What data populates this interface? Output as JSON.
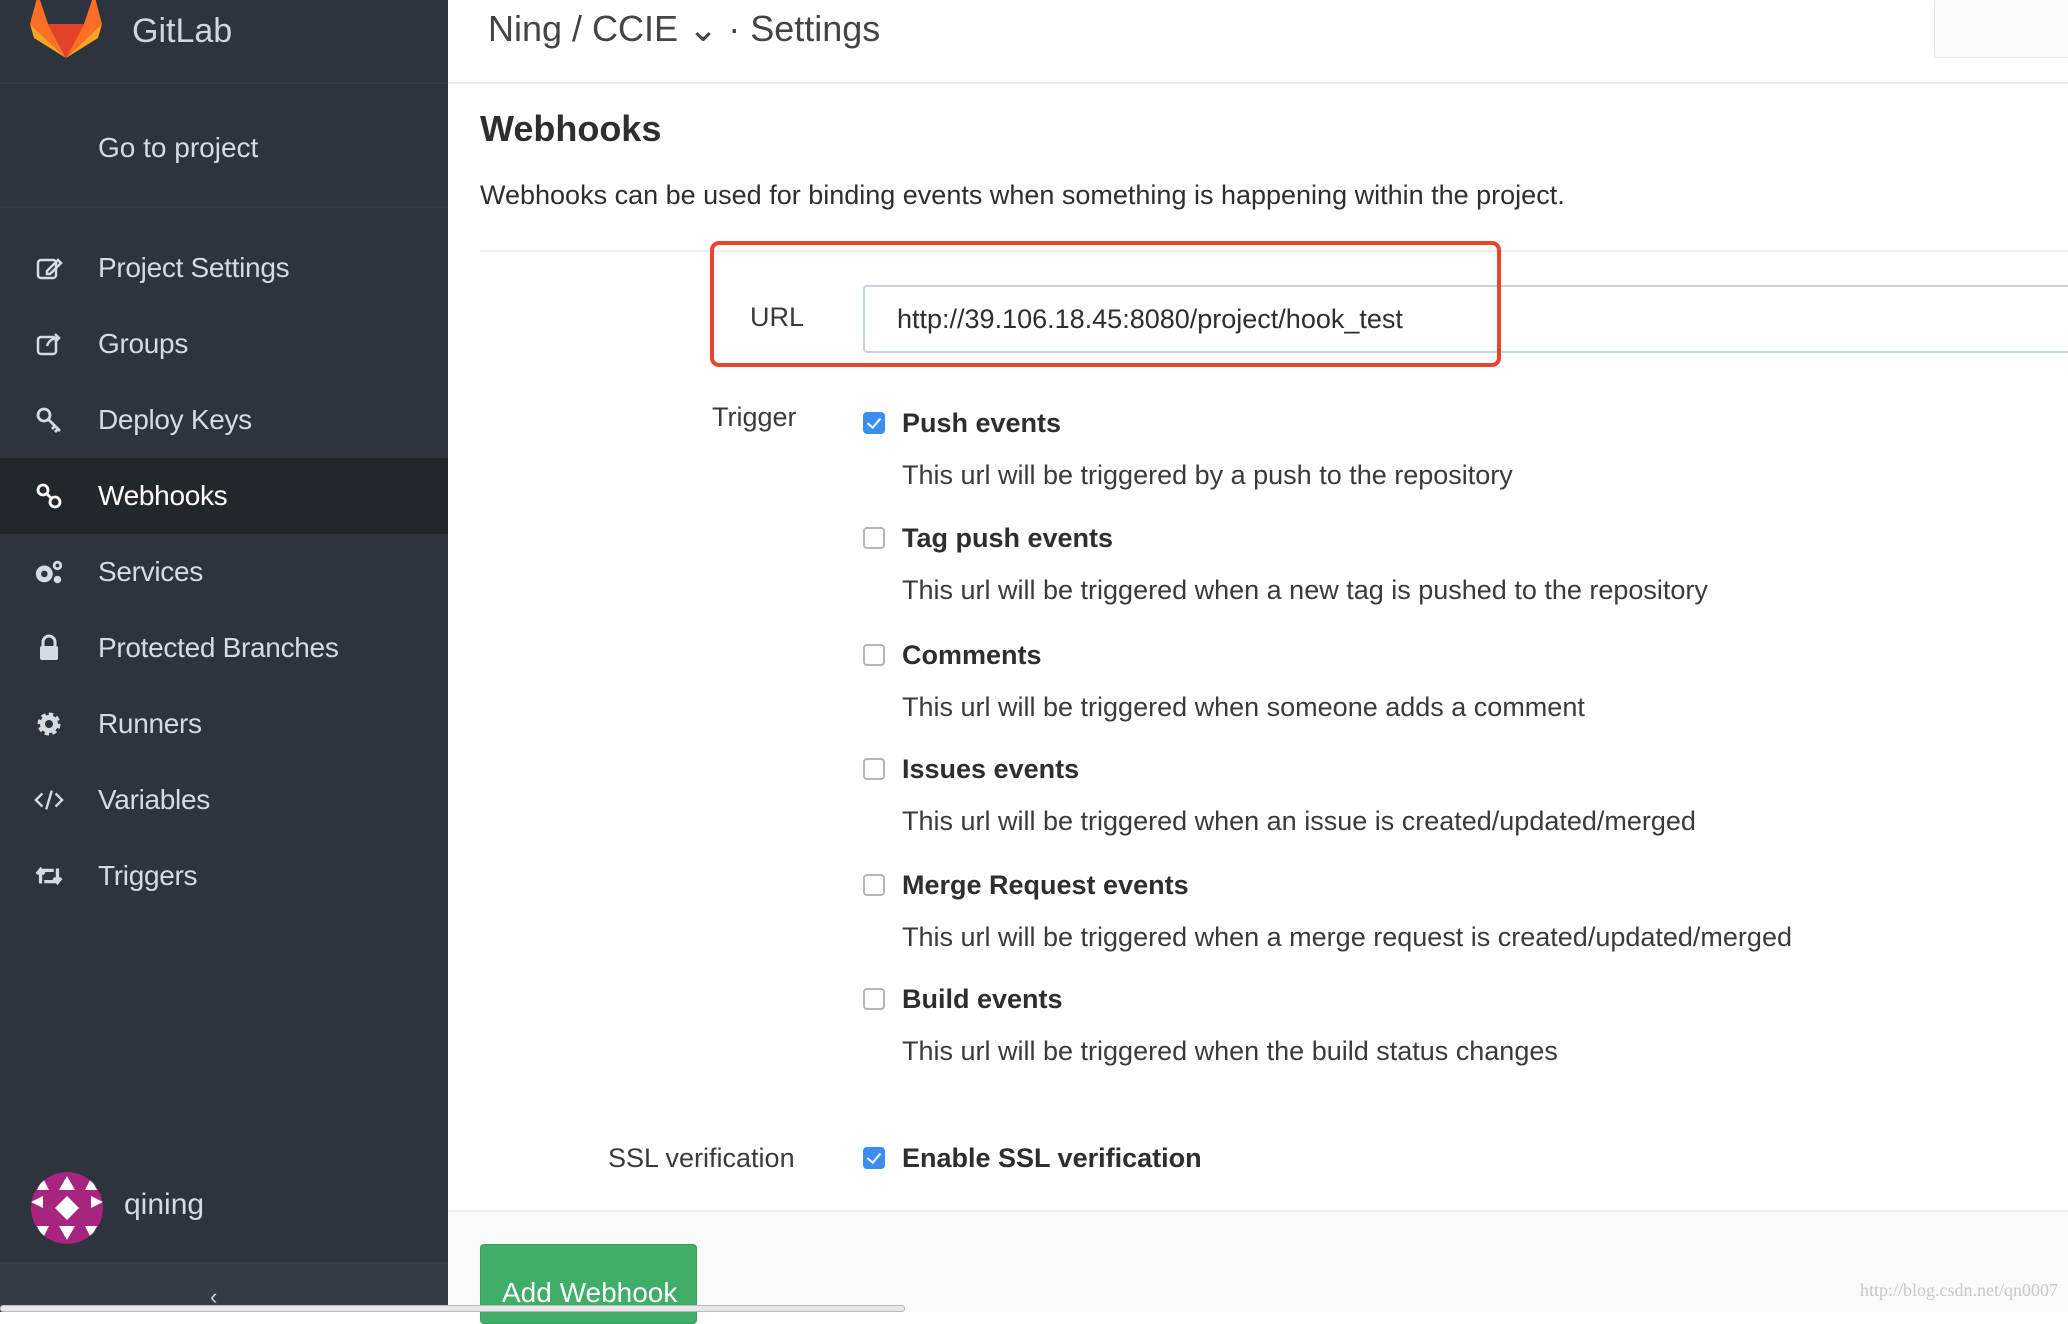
{
  "sidebar": {
    "brand": "GitLab",
    "go_to_project": "Go to project",
    "items": [
      {
        "label": "Project Settings",
        "icon": "edit-icon"
      },
      {
        "label": "Groups",
        "icon": "share-icon"
      },
      {
        "label": "Deploy Keys",
        "icon": "key-icon"
      },
      {
        "label": "Webhooks",
        "icon": "link-icon",
        "active": true
      },
      {
        "label": "Services",
        "icon": "cogs-icon"
      },
      {
        "label": "Protected Branches",
        "icon": "lock-icon"
      },
      {
        "label": "Runners",
        "icon": "gear-icon"
      },
      {
        "label": "Variables",
        "icon": "code-icon"
      },
      {
        "label": "Triggers",
        "icon": "retweet-icon"
      }
    ],
    "user": "qining",
    "collapse": "‹"
  },
  "header": {
    "breadcrumb": "Ning / CCIE ⌄ · Settings"
  },
  "main": {
    "title": "Webhooks",
    "description": "Webhooks can be used for binding events when something is happening within the project.",
    "url_label": "URL",
    "url_value": "http://39.106.18.45:8080/project/hook_test",
    "trigger_label": "Trigger",
    "triggers": [
      {
        "label": "Push events",
        "desc": "This url will be triggered by a push to the repository",
        "checked": true
      },
      {
        "label": "Tag push events",
        "desc": "This url will be triggered when a new tag is pushed to the repository",
        "checked": false
      },
      {
        "label": "Comments",
        "desc": "This url will be triggered when someone adds a comment",
        "checked": false
      },
      {
        "label": "Issues events",
        "desc": "This url will be triggered when an issue is created/updated/merged",
        "checked": false
      },
      {
        "label": "Merge Request events",
        "desc": "This url will be triggered when a merge request is created/updated/merged",
        "checked": false
      },
      {
        "label": "Build events",
        "desc": "This url will be triggered when the build status changes",
        "checked": false
      }
    ],
    "ssl_label": "SSL verification",
    "ssl_option": "Enable SSL verification",
    "ssl_checked": true,
    "add_button": "Add Webhook"
  },
  "watermark": "http://blog.csdn.net/qn0007",
  "colors": {
    "sidebar": "#2e343d",
    "active": "#22272e",
    "highlight": "#e8452c",
    "button": "#3fae68",
    "checkbox": "#3a8ef2"
  }
}
